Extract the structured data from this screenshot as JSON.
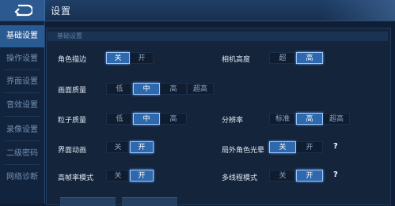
{
  "header": {
    "title": "设置"
  },
  "sidebar": {
    "items": [
      {
        "label": "基础设置",
        "active": true
      },
      {
        "label": "操作设置"
      },
      {
        "label": "界面设置"
      },
      {
        "label": "音效设置"
      },
      {
        "label": "录像设置"
      },
      {
        "label": "二级密码"
      },
      {
        "label": "网络诊断"
      }
    ]
  },
  "section": {
    "title": "基础设置"
  },
  "settings": {
    "outline": {
      "label": "角色描边",
      "options": [
        "关",
        "开"
      ],
      "selected": "关"
    },
    "camera_height": {
      "label": "相机高度",
      "options": [
        "超",
        "高"
      ],
      "selected": "高"
    },
    "graphics_quality": {
      "label": "画面质量",
      "options": [
        "低",
        "中",
        "高",
        "超高"
      ],
      "selected": "中"
    },
    "particle_quality": {
      "label": "粒子质量",
      "options": [
        "低",
        "中",
        "高"
      ],
      "selected": "中"
    },
    "resolution": {
      "label": "分辨率",
      "options": [
        "标准",
        "高",
        "超高"
      ],
      "selected": "高"
    },
    "ui_animation": {
      "label": "界面动画",
      "options": [
        "关",
        "开"
      ],
      "selected": "开"
    },
    "outer_glow": {
      "label": "局外角色光晕",
      "options": [
        "关",
        "开"
      ],
      "selected": "关",
      "help": "?"
    },
    "high_fps": {
      "label": "高帧率模式",
      "options": [
        "关",
        "开"
      ],
      "selected": "开"
    },
    "multithread": {
      "label": "多线程模式",
      "options": [
        "关",
        "开"
      ],
      "selected": "开",
      "help": "?"
    }
  },
  "colors": {
    "accent": "#2f69ad",
    "background": "#0f1e34",
    "sidebar_active": "#2a5a92"
  }
}
